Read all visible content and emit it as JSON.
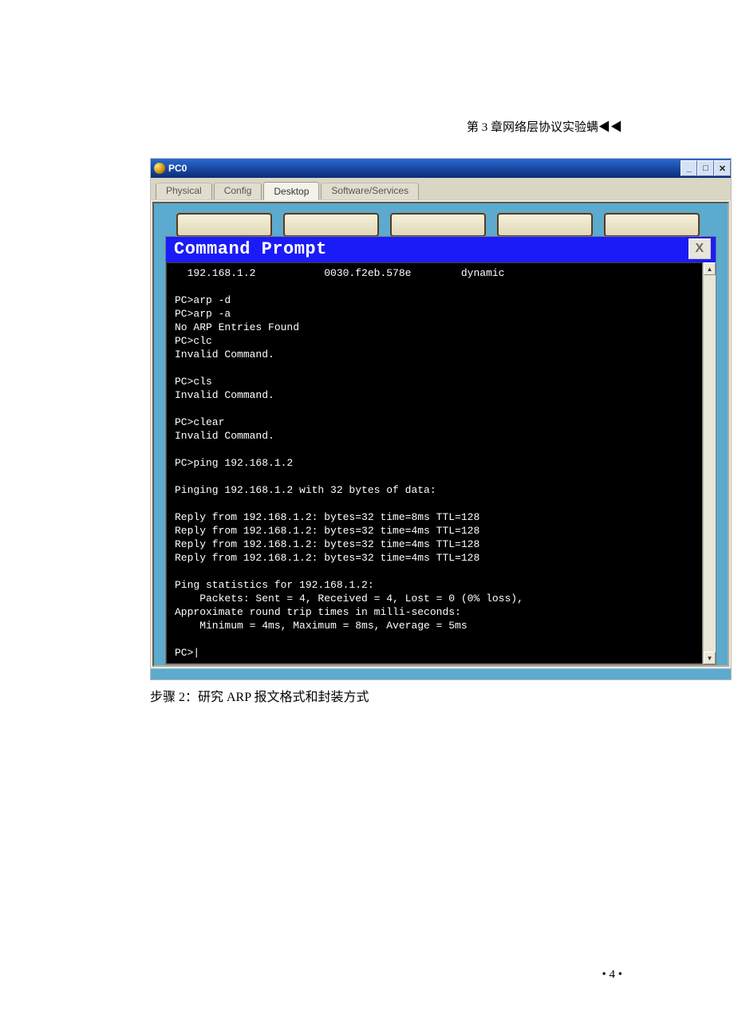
{
  "header_text": "第 3 章网络层协议实验螨◀◀",
  "caption": "步骤 2：研究 ARP 报文格式和封装方式",
  "page_number": "• 4 •",
  "window": {
    "title": "PC0",
    "min_glyph": "_",
    "max_glyph": "□",
    "close_glyph": "✕",
    "tabs": {
      "physical": "Physical",
      "config": "Config",
      "desktop": "Desktop",
      "software": "Software/Services"
    }
  },
  "cmd": {
    "title": "Command Prompt",
    "close": "X",
    "output": "  192.168.1.2           0030.f2eb.578e        dynamic\n\nPC>arp -d\nPC>arp -a\nNo ARP Entries Found\nPC>clc\nInvalid Command.\n\nPC>cls\nInvalid Command.\n\nPC>clear\nInvalid Command.\n\nPC>ping 192.168.1.2\n\nPinging 192.168.1.2 with 32 bytes of data:\n\nReply from 192.168.1.2: bytes=32 time=8ms TTL=128\nReply from 192.168.1.2: bytes=32 time=4ms TTL=128\nReply from 192.168.1.2: bytes=32 time=4ms TTL=128\nReply from 192.168.1.2: bytes=32 time=4ms TTL=128\n\nPing statistics for 192.168.1.2:\n    Packets: Sent = 4, Received = 4, Lost = 0 (0% loss),\nApproximate round trip times in milli-seconds:\n    Minimum = 4ms, Maximum = 8ms, Average = 5ms\n\nPC>|",
    "scroll_up": "▲",
    "scroll_down": "▼"
  }
}
